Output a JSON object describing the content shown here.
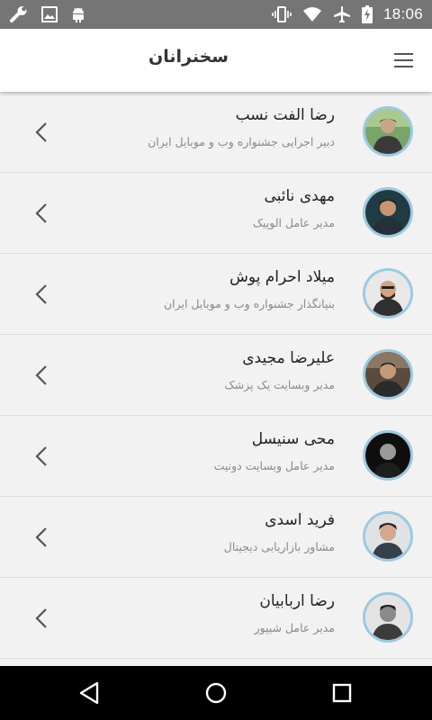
{
  "status_bar": {
    "time": "18:06",
    "left_icons": [
      "wrench-icon",
      "image-icon",
      "android-icon"
    ],
    "right_icons": [
      "vibrate-icon",
      "wifi-icon",
      "airplane-icon",
      "battery-charging-icon"
    ]
  },
  "app_bar": {
    "title": "سخنرانان",
    "menu_icon": "hamburger-menu-icon"
  },
  "speakers": [
    {
      "name": "رضا الفت نسب",
      "role": "دبیر اجرایی جشنواره وب و موبایل ایران"
    },
    {
      "name": "مهدی نائبی",
      "role": "مدیر عامل الوپیک"
    },
    {
      "name": "میلاد احرام پوش",
      "role": "بنیانگذار جشنواره وب و موبایل ایران"
    },
    {
      "name": "علیرضا مجیدی",
      "role": "مدیر وبسایت یک پزشک"
    },
    {
      "name": "محی سنیسل",
      "role": "مدیر عامل وبسایت دونیت"
    },
    {
      "name": "فرید اسدی",
      "role": "مشاور بازاریابی دیجیتال"
    },
    {
      "name": "رضا اربابیان",
      "role": "مدیر عامل شیپور"
    }
  ],
  "nav_bar": {
    "icons": [
      "back-icon",
      "home-icon",
      "recents-icon"
    ]
  },
  "colors": {
    "status_bar": "#757575",
    "app_bar": "#ffffff",
    "list_bg": "#f2f2f2",
    "avatar_ring": "#9ec8e0",
    "name_text": "#222222",
    "role_text": "#8a8a8a"
  }
}
